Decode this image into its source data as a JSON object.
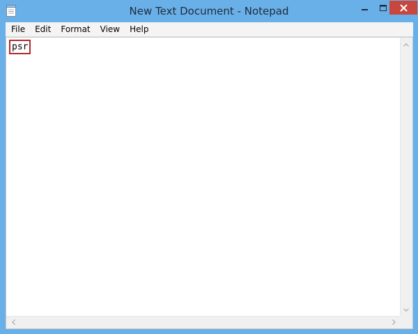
{
  "window": {
    "title": "New Text Document - Notepad",
    "frame_color": "#6ab0e8",
    "close_color": "#c7473f"
  },
  "icons": {
    "app": "notepad-icon",
    "minimize": "minimize-icon",
    "maximize": "maximize-icon",
    "close": "close-icon",
    "scroll_up": "chevron-up-icon",
    "scroll_down": "chevron-down-icon",
    "scroll_left": "chevron-left-icon",
    "scroll_right": "chevron-right-icon"
  },
  "menu": {
    "items": [
      {
        "label": "File"
      },
      {
        "label": "Edit"
      },
      {
        "label": "Format"
      },
      {
        "label": "View"
      },
      {
        "label": "Help"
      }
    ]
  },
  "editor": {
    "content": "psr",
    "highlight_color": "#b3262b"
  }
}
